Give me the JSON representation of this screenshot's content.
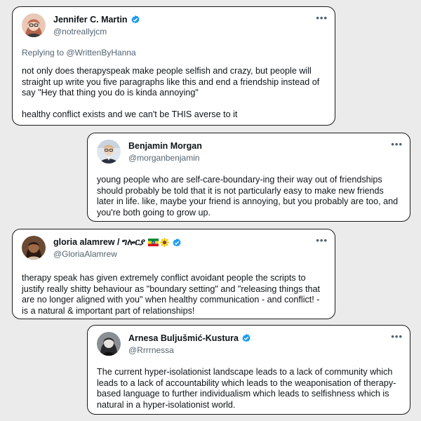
{
  "tweets": [
    {
      "name": "Jennifer C. Martin",
      "handle": "@notreallyjcm",
      "verified": true,
      "reply_prefix": "Replying to ",
      "reply_to": "@WrittenByHanna",
      "text": "not only does therapyspeak make people selfish and crazy, but people will straight up write you five paragraphs like this and end a friendship instead of say \"Hey that thing you do is kinda annoying\"\n\nhealthy conflict exists and we can't be THIS averse to it",
      "avatar_icon": "woman-avatar-icon"
    },
    {
      "name": "Benjamin Morgan",
      "handle": "@morganbenjamin",
      "verified": false,
      "text": "young people who are self-care-boundary-ing their way out of friendships should probably be told that it is not particularly easy to make new friends later in life. like, maybe your friend is annoying, but you probably are too, and you're both going to grow up.",
      "avatar_icon": "man-avatar-icon"
    },
    {
      "name": "gloria alamrew / ግሎርያ",
      "handle": "@GloriaAlamrew",
      "verified": true,
      "emoji": [
        "ethiopia-flag-icon",
        "sunflower-icon"
      ],
      "text": "therapy speak has given extremely conflict avoidant people the scripts to justify really shitty behaviour as \"boundary setting\" and \"releasing things that are no longer aligned with you\" when healthy communication - and conflict! - is a natural & important part of relationships!",
      "avatar_icon": "woman-avatar-icon"
    },
    {
      "name": "Arnesa Buljušmić-Kustura",
      "handle": "@Rrrrnessa",
      "verified": true,
      "text": "The current hyper-isolationist landscape leads to a lack of community which leads to a lack of accountability which leads to the weaponisation of therapy-based language to further individualism which leads to selfishness which is natural in a hyper-isolationist world.",
      "avatar_icon": "woman-avatar-icon"
    }
  ],
  "more_label": "•••",
  "colors": {
    "verified": "#1d9bf0",
    "secondary_text": "#536471",
    "background": "#ebebeb"
  }
}
